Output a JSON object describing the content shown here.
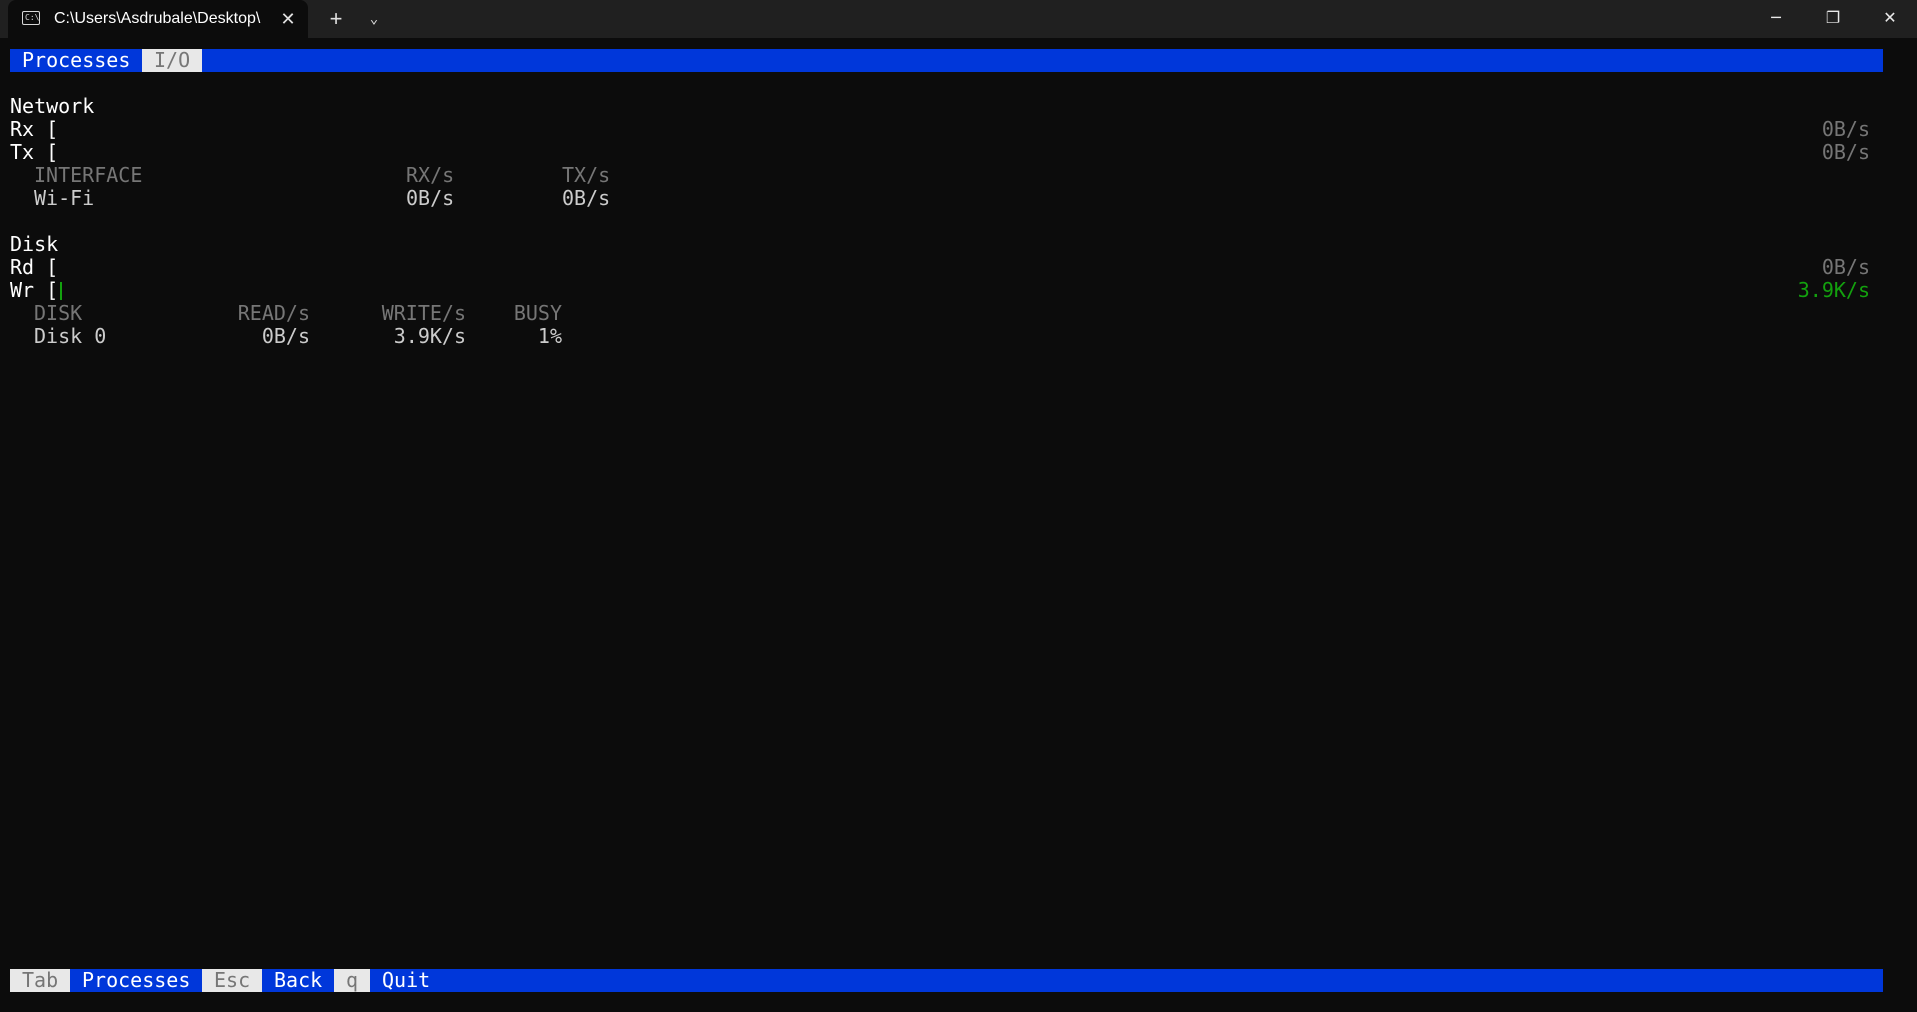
{
  "window": {
    "tab_title": "C:\\Users\\Asdrubale\\Desktop\\",
    "tab_icon": "terminal-icon",
    "close_tab_glyph": "✕",
    "new_tab_glyph": "+",
    "dropdown_glyph": "⌄",
    "minimize_glyph": "─",
    "maximize_glyph": "❐",
    "close_glyph": "✕"
  },
  "top_tabs": {
    "processes": "Processes",
    "io": "I/O"
  },
  "network": {
    "heading": "Network",
    "rx_label": "Rx [",
    "tx_label": "Tx [",
    "rx_rate": "0B/s",
    "tx_rate": "0B/s",
    "columns": [
      "INTERFACE",
      "RX/s",
      "TX/s"
    ],
    "rows": [
      {
        "interface": "Wi-Fi",
        "rx": "0B/s",
        "tx": "0B/s"
      }
    ]
  },
  "disk": {
    "heading": "Disk",
    "rd_label": "Rd [",
    "wr_label": "Wr [",
    "rd_rate": "0B/s",
    "wr_rate": "3.9K/s",
    "columns": [
      "DISK",
      "READ/s",
      "WRITE/s",
      "BUSY"
    ],
    "rows": [
      {
        "disk": "Disk 0",
        "read": "0B/s",
        "write": "3.9K/s",
        "busy": "1%"
      }
    ]
  },
  "footer": {
    "tab_key": "Tab",
    "tab_action": "Processes",
    "esc_key": "Esc",
    "esc_action": "Back",
    "q_key": "q",
    "q_action": "Quit"
  },
  "colors": {
    "bar_blue": "#0037da",
    "active_rate_green": "#13a10e",
    "dim_gray": "#767676"
  }
}
